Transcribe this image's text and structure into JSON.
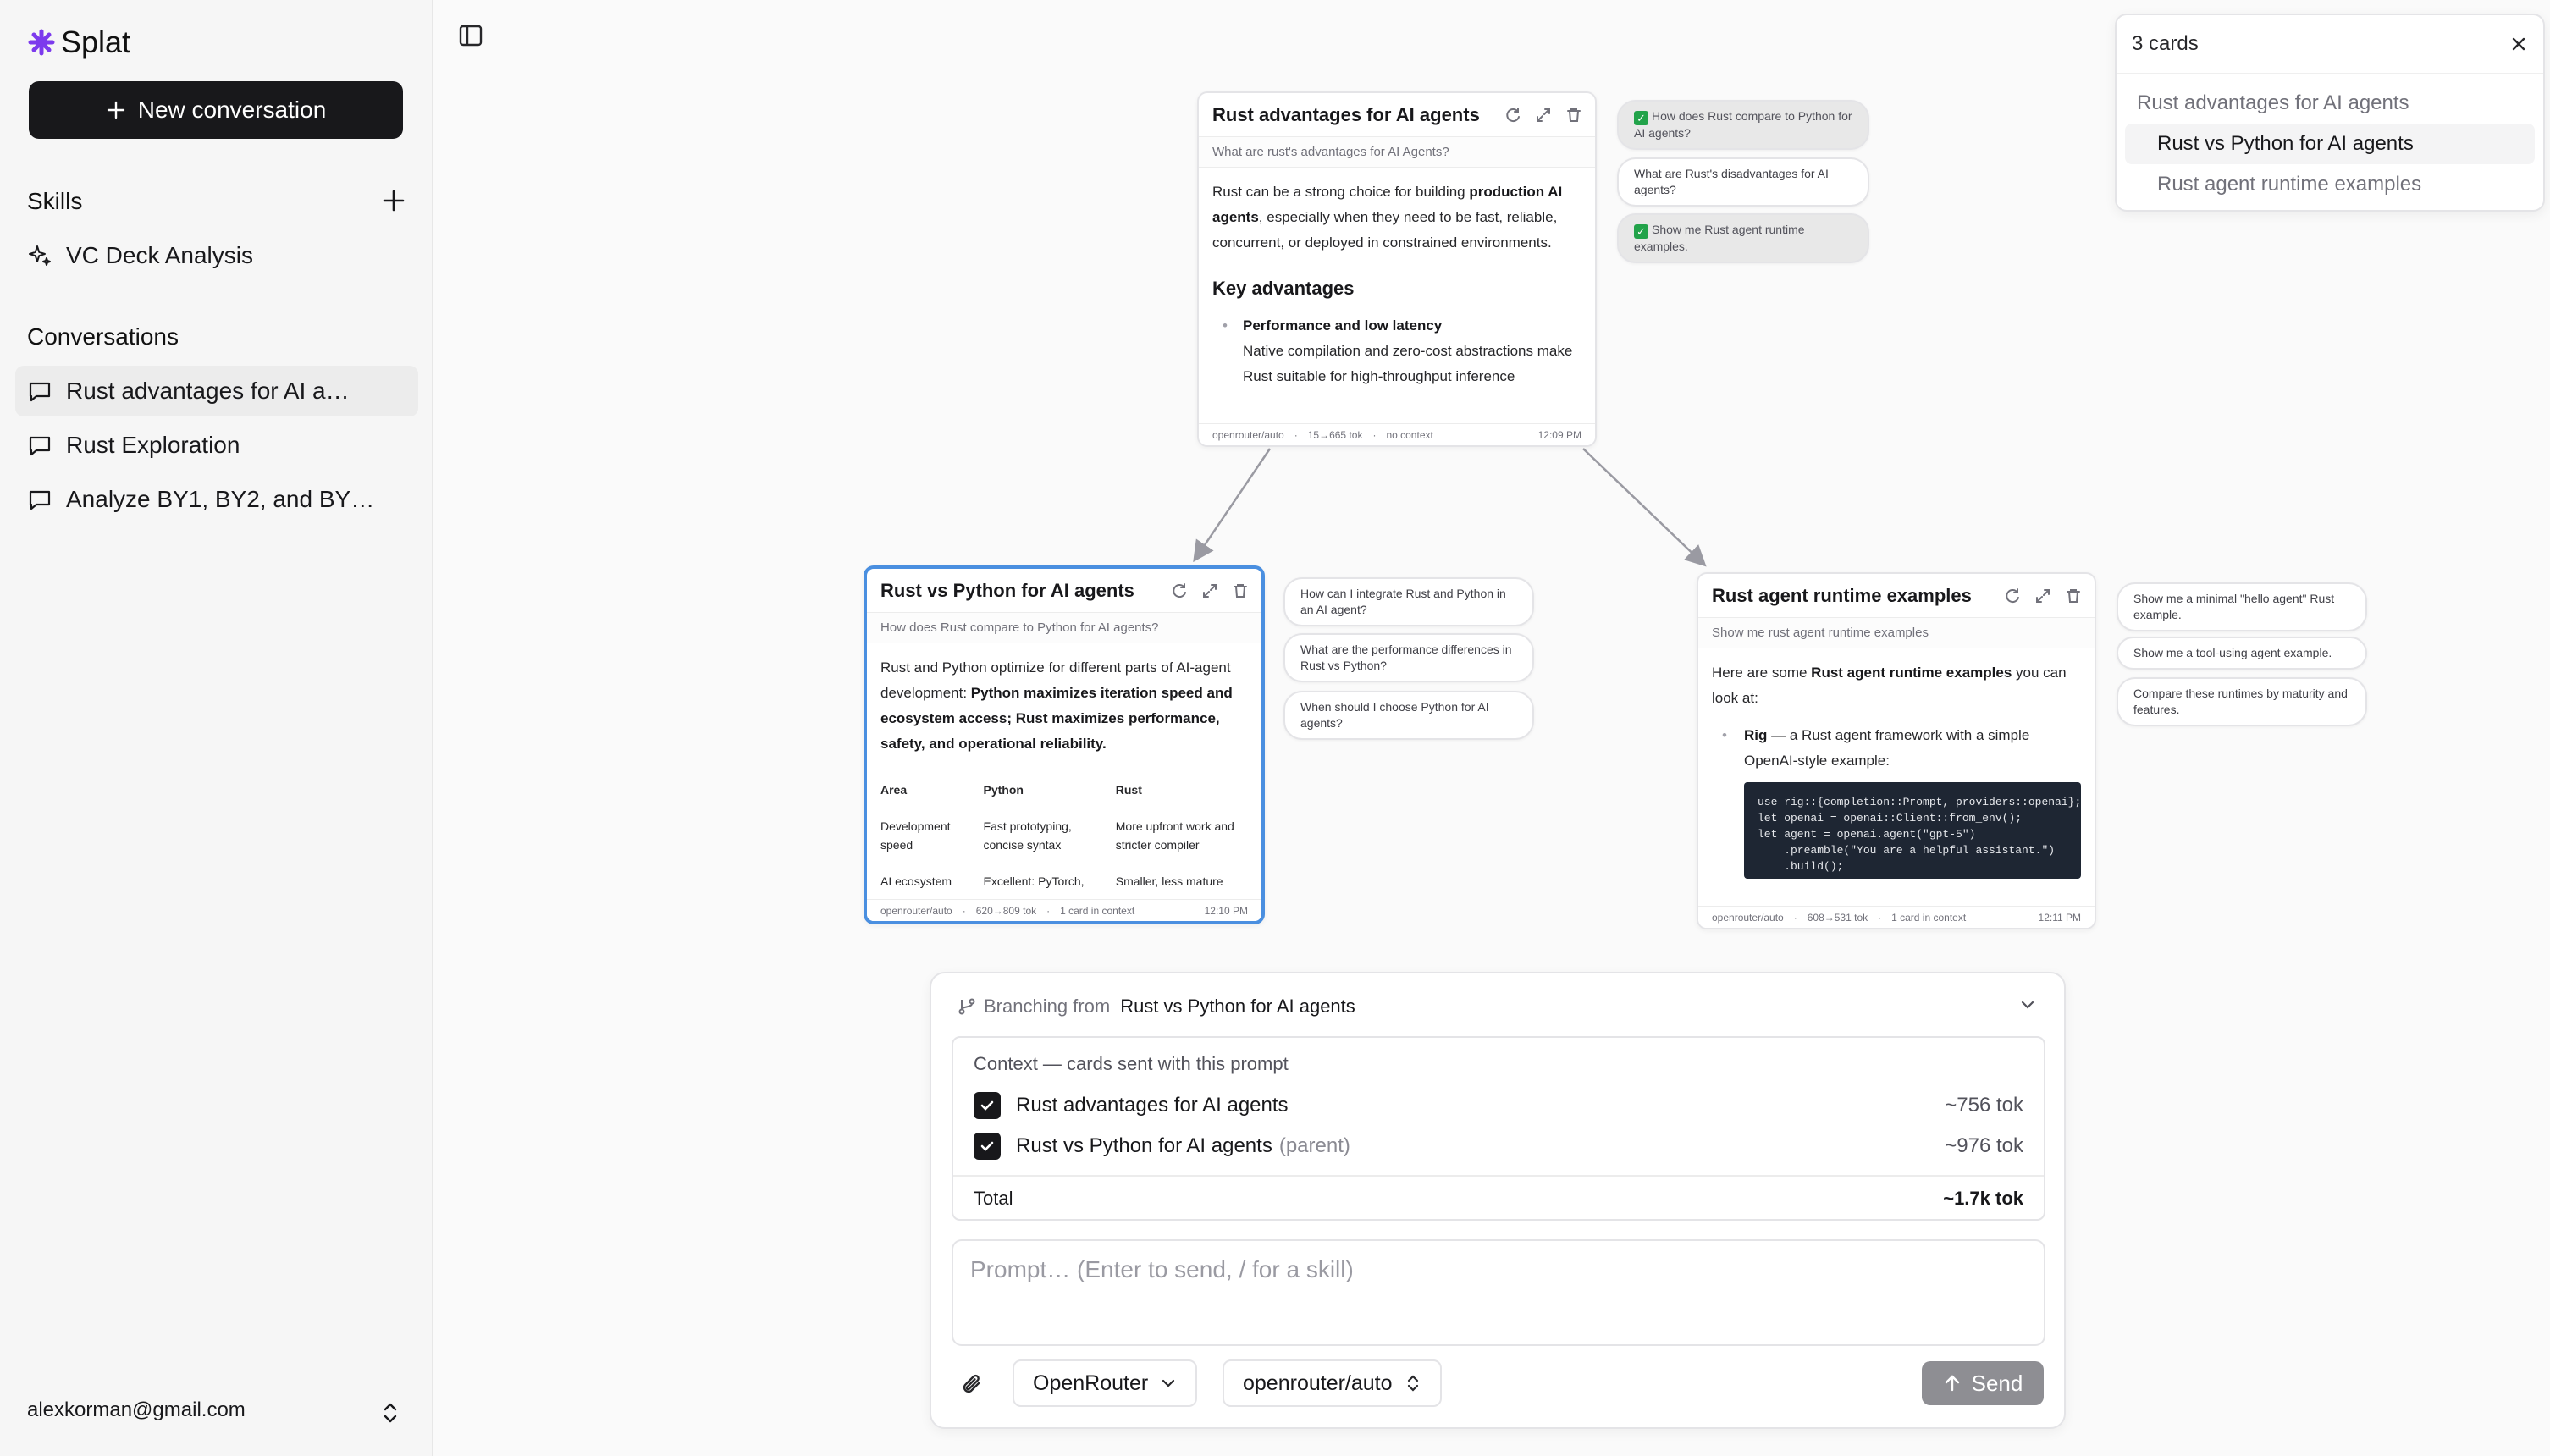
{
  "app": {
    "name": "Splat"
  },
  "sidebar": {
    "new_conversation": "New conversation",
    "skills_title": "Skills",
    "skills": [
      {
        "label": "VC Deck Analysis"
      }
    ],
    "conversations_title": "Conversations",
    "conversations": [
      {
        "label": "Rust advantages for AI a…"
      },
      {
        "label": "Rust Exploration"
      },
      {
        "label": "Analyze BY1, BY2, and BY…"
      }
    ],
    "user_email": "alexkorman@gmail.com"
  },
  "cards": {
    "advantages": {
      "title": "Rust advantages for AI agents",
      "question": "What are rust's advantages for AI Agents?",
      "intro_a": "Rust can be a strong choice for building ",
      "intro_b": "production AI agents",
      "intro_c": ", especially when they need to be fast, reliable, concurrent, or deployed in constrained environments.",
      "heading": "Key advantages",
      "bullet_title": "Performance and low latency",
      "bullet_text": "Native compilation and zero-cost abstractions make Rust suitable for high-throughput inference",
      "footer": {
        "model": "openrouter/auto",
        "tokens": "15→665 tok",
        "context": "no context",
        "time": "12:09 PM"
      }
    },
    "python": {
      "title": "Rust vs Python for AI agents",
      "question": "How does Rust compare to Python for AI agents?",
      "intro_a": "Rust and Python optimize for different parts of AI-agent development: ",
      "intro_b": "Python maximizes iteration speed and ecosystem access; Rust maximizes performance, safety, and operational reliability.",
      "table": {
        "headers": [
          "Area",
          "Python",
          "Rust"
        ],
        "rows": [
          [
            "Development speed",
            "Fast prototyping, concise syntax",
            "More upfront work and stricter compiler"
          ],
          [
            "AI ecosystem",
            "Excellent: PyTorch,",
            "Smaller, less mature"
          ]
        ]
      },
      "footer": {
        "model": "openrouter/auto",
        "tokens": "620→809 tok",
        "context": "1 card in context",
        "time": "12:10 PM"
      }
    },
    "runtime": {
      "title": "Rust agent runtime examples",
      "question": "Show me rust agent runtime examples",
      "intro_a": "Here are some ",
      "intro_b": "Rust agent runtime examples",
      "intro_c": " you can look at:",
      "bullet_title": "Rig",
      "bullet_text": " — a Rust agent framework with a simple OpenAI-style example:",
      "code": "use rig::{completion::Prompt, providers::openai};\nlet openai = openai::Client::from_env();\nlet agent = openai.agent(\"gpt-5\")\n    .preamble(\"You are a helpful assistant.\")\n    .build();",
      "footer": {
        "model": "openrouter/auto",
        "tokens": "608→531 tok",
        "context": "1 card in context",
        "time": "12:11 PM"
      }
    }
  },
  "followups": {
    "advantages": [
      {
        "text": "How does Rust compare to Python for AI agents?",
        "used": true
      },
      {
        "text": "What are Rust's disadvantages for AI agents?",
        "used": false
      },
      {
        "text": "Show me Rust agent runtime examples.",
        "used": true
      }
    ],
    "python": [
      {
        "text": "How can I integrate Rust and Python in an AI agent?"
      },
      {
        "text": "What are the performance differences in Rust vs Python?"
      },
      {
        "text": "When should I choose Python for AI agents?"
      }
    ],
    "runtime": [
      {
        "text": "Show me a minimal \"hello agent\" Rust example."
      },
      {
        "text": "Show me a tool-using agent example."
      },
      {
        "text": "Compare these runtimes by maturity and features."
      }
    ]
  },
  "cards_panel": {
    "title": "3 cards",
    "items": [
      "Rust advantages for AI agents",
      "Rust vs Python for AI agents",
      "Rust agent runtime examples"
    ]
  },
  "composer": {
    "branch_label": "Branching from",
    "branch_card": "Rust vs Python for AI agents",
    "context_title": "Context — cards sent with this prompt",
    "context_items": [
      {
        "label": "Rust advantages for AI agents",
        "suffix": "",
        "tokens": "~756 tok"
      },
      {
        "label": "Rust vs Python for AI agents",
        "suffix": "(parent)",
        "tokens": "~976 tok"
      }
    ],
    "total_label": "Total",
    "total_tokens": "~1.7k tok",
    "placeholder": "Prompt… (Enter to send, / for a skill)",
    "provider": "OpenRouter",
    "model": "openrouter/auto",
    "send": "Send"
  },
  "colors": {
    "accent": "#4a8fe0",
    "brand": "#7c3aed",
    "dark": "#18181b",
    "check": "#22a34a"
  }
}
